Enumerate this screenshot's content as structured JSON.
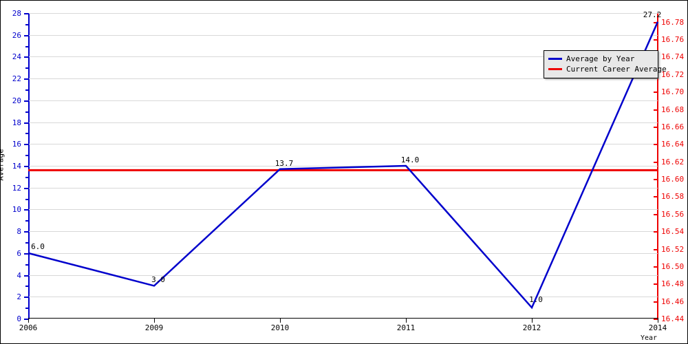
{
  "chart_data": {
    "type": "line",
    "title": "",
    "xlabel": "Year",
    "ylabel": "Average",
    "categories": [
      "2006",
      "2009",
      "2010",
      "2011",
      "2012",
      "2014"
    ],
    "series": [
      {
        "name": "Average by Year",
        "color": "#0000cc",
        "values": [
          6.0,
          3.0,
          13.7,
          14.0,
          1.0,
          27.2
        ],
        "point_labels": [
          "6.0",
          "3.0",
          "13.7",
          "14.0",
          "1.0",
          "27.2"
        ]
      },
      {
        "name": "Current Career Average",
        "color": "#ee0000",
        "constant_value": 13.6,
        "values": [
          13.6,
          13.6,
          13.6,
          13.6,
          13.6,
          13.6
        ]
      }
    ],
    "ylim": [
      0,
      28
    ],
    "ytick_labels": [
      "0",
      "2",
      "4",
      "6",
      "8",
      "10",
      "12",
      "14",
      "16",
      "18",
      "20",
      "22",
      "24",
      "26",
      "28"
    ],
    "ytick_values": [
      0,
      2,
      4,
      6,
      8,
      10,
      12,
      14,
      16,
      18,
      20,
      22,
      24,
      26,
      28
    ],
    "y2lim": [
      16.44,
      16.79
    ],
    "y2tick_labels": [
      "16.44",
      "16.46",
      "16.48",
      "16.50",
      "16.52",
      "16.54",
      "16.56",
      "16.58",
      "16.60",
      "16.62",
      "16.64",
      "16.66",
      "16.68",
      "16.70",
      "16.72",
      "16.74",
      "16.76",
      "16.78"
    ],
    "y2tick_values": [
      16.44,
      16.46,
      16.48,
      16.5,
      16.52,
      16.54,
      16.56,
      16.58,
      16.6,
      16.62,
      16.64,
      16.66,
      16.68,
      16.7,
      16.72,
      16.74,
      16.76,
      16.78
    ],
    "grid": true,
    "legend_position": "top-right",
    "axis_colors": {
      "left_axis": "#0000cc",
      "right_axis": "#ee0000",
      "bottom_axis": "#000000",
      "gridline": "#d8d8d8"
    }
  },
  "legend": {
    "items": [
      {
        "label": "Average by Year",
        "color": "#0000cc"
      },
      {
        "label": "Current Career Average",
        "color": "#ee0000"
      }
    ]
  },
  "axes": {
    "y_title": "Average",
    "x_title": "Year"
  }
}
